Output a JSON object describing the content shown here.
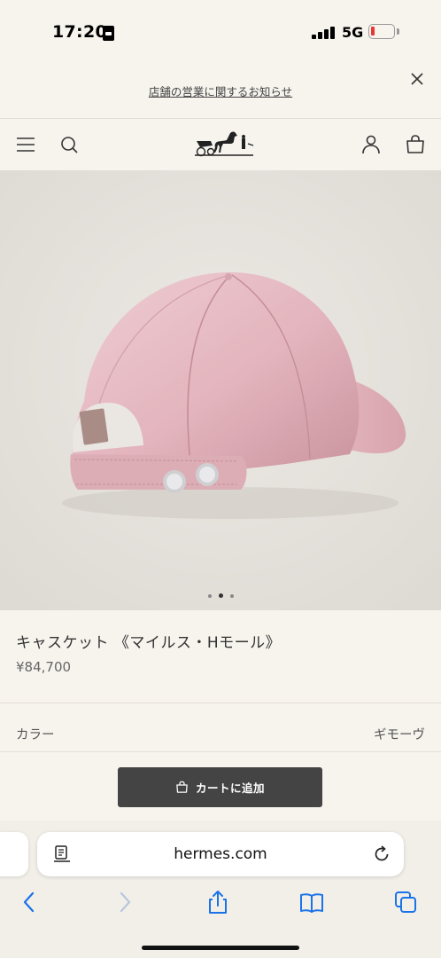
{
  "status_bar": {
    "time": "17:20",
    "network": "5G",
    "battery_level": 0.1
  },
  "notice": {
    "text": "店舗の営業に関するお知らせ"
  },
  "header": {
    "menu_icon": "hamburger-icon",
    "search_icon": "search-icon",
    "logo": "hermes-carriage-logo",
    "account_icon": "user-icon",
    "bag_icon": "shopping-bag-icon"
  },
  "product": {
    "name": "キャスケット 《マイルス・Hモール》",
    "price": "¥84,700",
    "image_count": 3,
    "active_image": 2,
    "color_label": "カラー",
    "color_value": "ギモーヴ",
    "cap_color": "#e6bcc4"
  },
  "cart_button": {
    "label": "カートに追加"
  },
  "browser": {
    "url": "hermes.com"
  },
  "colors": {
    "background": "#f7f4ee",
    "button": "#444444",
    "link_blue": "#1a73e8"
  }
}
